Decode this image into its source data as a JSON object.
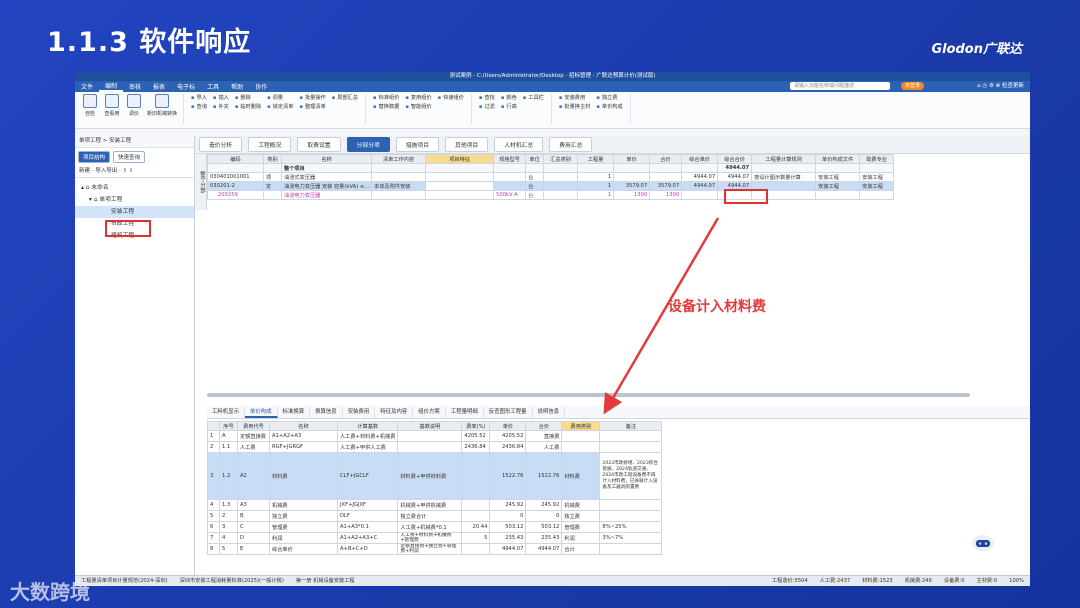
{
  "slide": {
    "title": "1.1.3 软件响应",
    "brand": "Glodon广联达",
    "watermark": "大数跨境",
    "annotation": "设备计入材料费"
  },
  "app": {
    "window_title": "测试案例 - C:/Users/Administrator/Desktop · 招标管理 · 广联达预算计价(测试版)",
    "menu": [
      "文件",
      "编制",
      "审核",
      "报表",
      "电子标",
      "工具",
      "帮助",
      "协作"
    ],
    "search_placeholder": "请输入功能名称或问题描述",
    "badge": "未登录",
    "right_icons": "⌂  ◷  ⚙  ⊗ 检查更新",
    "ribbon": {
      "big": [
        "自检",
        "查看用",
        "调价",
        "新旧机械转换"
      ],
      "cols": [
        [
          "导入",
          "查询",
          "—"
        ],
        [
          "插入",
          "补充"
        ],
        [
          "删除",
          "临时删除"
        ],
        [
          "调量",
          "锁定清单"
        ],
        [
          "批量操作",
          "整理清单"
        ],
        [
          "局部汇总"
        ],
        [
          "标准组价",
          "替换数据"
        ],
        [
          "复用组价",
          "智能组价"
        ],
        [
          "快速组价"
        ],
        [
          "查找",
          "过滤"
        ],
        [
          "颜色",
          "行高"
        ],
        [
          "工具栏"
        ],
        [
          "安装费用",
          "批量换主材"
        ],
        [
          "独立费",
          "单价构成"
        ]
      ]
    },
    "left": {
      "header": "单项工程 > 安装工程",
      "tab1": "项目结构",
      "tab2": "快速查询",
      "tools": "新建 ·  导入导出 ·  ⇧  ⇩",
      "tree": [
        "未命名",
        "单项工程",
        "安装工程",
        "市政工程",
        "建筑工程"
      ]
    },
    "main_tabs": [
      "造价分析",
      "工程概况",
      "取费设置",
      "分部分项",
      "措施项目",
      "其他项目",
      "人材机汇总",
      "费用汇总"
    ],
    "side_label": "整个分部",
    "upper_headers": [
      "编码",
      "类别",
      "名称",
      "清单工作内容",
      "项目特征",
      "规格型号",
      "单位",
      "汇总类别",
      "工程量",
      "单价",
      "合价",
      "综合单价",
      "综合合价",
      "工程量计算规则",
      "单价构成文件",
      "取费专业"
    ],
    "upper_rows": [
      [
        "",
        "",
        "整个项目",
        "",
        "",
        "",
        "",
        "",
        "",
        "",
        "",
        "",
        "4944.07",
        "",
        "",
        ""
      ],
      [
        "030401001001",
        "项",
        "油浸式变压器",
        "",
        "",
        "",
        "台",
        "",
        "1",
        "",
        "",
        "4944.07",
        "4944.07",
        "按设计图示数量计算",
        "安装工程",
        "安装工程"
      ],
      [
        "030201-2",
        "定",
        "油浸电力变压器 安装 容量(kVA) ≤...",
        "本体及附件安装",
        "",
        "",
        "台",
        "",
        "1",
        "3579.07",
        "3579.07",
        "4944.07",
        "4944.07",
        "",
        "安装工程",
        "安装工程"
      ],
      [
        "200259",
        "",
        "油浸电力变压器",
        "",
        "",
        "500kV·A",
        "台",
        "",
        "1",
        "1300",
        "1300",
        "",
        "",
        "",
        "",
        ""
      ]
    ],
    "lower_tabs": [
      "工料机显示",
      "单价构成",
      "标准换算",
      "换算信息",
      "安装费用",
      "特征及内容",
      "组价方案",
      "工程量明细",
      "反查图形工程量",
      "说明信息"
    ],
    "lower_headers": [
      "序号",
      "费用代号",
      "名称",
      "计算基数",
      "基数说明",
      "费率(%)",
      "单价",
      "合价",
      "费用类别",
      "备注"
    ],
    "lower_rows": [
      [
        "1",
        "A",
        "定额直接费",
        "A1+A2+A3",
        "人工费+材料费+机械费",
        "",
        "4205.52",
        "4205.52",
        "直接费",
        ""
      ],
      [
        "2",
        "1.1",
        "人工费",
        "RGF+JGRGF",
        "人工费+甲供人工费",
        "",
        "2436.84",
        "2436.84",
        "人工费",
        ""
      ],
      [
        "3",
        "1.2",
        "A2",
        "材料费",
        "CLF+JGCLF",
        "材料费+甲供材料费",
        "",
        "1522.76",
        "1522.76",
        "材料费",
        "2023市政修缮、2023综合管廊、2024轨道交通、2024市政工程设备费不再计入材料费，已关联计入设备及工器具购置费"
      ],
      [
        "4",
        "1.3",
        "A3",
        "机械费",
        "JXF+JGJXF",
        "机械费+甲供机械费",
        "",
        "245.92",
        "245.92",
        "机械费",
        ""
      ],
      [
        "5",
        "2",
        "B",
        "独立费",
        "DLF",
        "独立费合计",
        "",
        "0",
        "0",
        "独立费",
        ""
      ],
      [
        "6",
        "3",
        "C",
        "管理费",
        "A1+A3*0.1",
        "人工费+机械费*0.1",
        "20.44",
        "503.12",
        "503.12",
        "管理费",
        "8%~25%"
      ],
      [
        "7",
        "4",
        "D",
        "利润",
        "A1+A2+A3+C",
        "人工费+材料费+机械费+管理费",
        "5",
        "235.43",
        "235.43",
        "利润",
        "3%~7%"
      ],
      [
        "8",
        "5",
        "E",
        "综合单价",
        "A+B+C+D",
        "定额直接费+独立费+管理费+利润",
        "",
        "4944.07",
        "4944.07",
        "合计",
        ""
      ]
    ],
    "status": [
      "工程量清单项目计量规范(2024-深圳)",
      "深圳市安装工程消耗量标准(2025)(一般计税)",
      "第一册 机械设备安装工程",
      "工程造价:5504",
      "人工费:2437",
      "材料费:1523",
      "机械费:246",
      "设备费:0",
      "主材费:0",
      "100%"
    ]
  }
}
